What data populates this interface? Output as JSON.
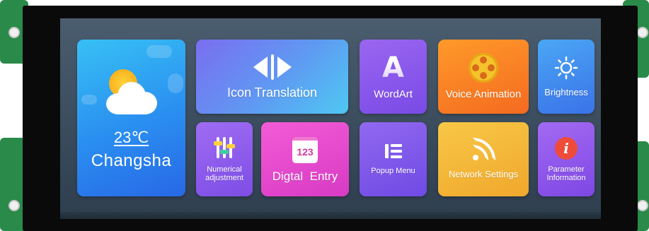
{
  "weather": {
    "temperature": "23℃",
    "city": "Changsha"
  },
  "tiles": {
    "icon_translation": "Icon Translation",
    "wordart": "WordArt",
    "wordart_glyph": "A",
    "voice_animation": "Voice Animation",
    "brightness": "Brightness",
    "numerical_line1": "Numerical",
    "numerical_line2": "adjustment",
    "digital_entry": "Digtal  Entry",
    "digital_entry_keypad": "123",
    "popup_menu": "Popup Menu",
    "network_settings": "Network Settings",
    "parameter_line1": "Parameter",
    "parameter_line2": "Information",
    "info_glyph": "i"
  },
  "icons": {
    "weather": "sun-cloud-icon",
    "icon_translation": "left-right-arrows-icon",
    "wordart": "letter-a-icon",
    "voice_animation": "film-reel-icon",
    "brightness": "sun-icon",
    "numerical": "sliders-icon",
    "digital_entry": "keypad-icon",
    "popup_menu": "menu-icon",
    "network_settings": "wifi-icon",
    "parameter_info": "info-icon"
  },
  "colors": {
    "pcb": "#2a8a4a",
    "screen_bg": "#4a5d6e",
    "weather_tile": "#2a8ef0",
    "voice_tile": "#f46a20",
    "network_tile": "#f0a82c",
    "digital_tile": "#d83ac4"
  }
}
